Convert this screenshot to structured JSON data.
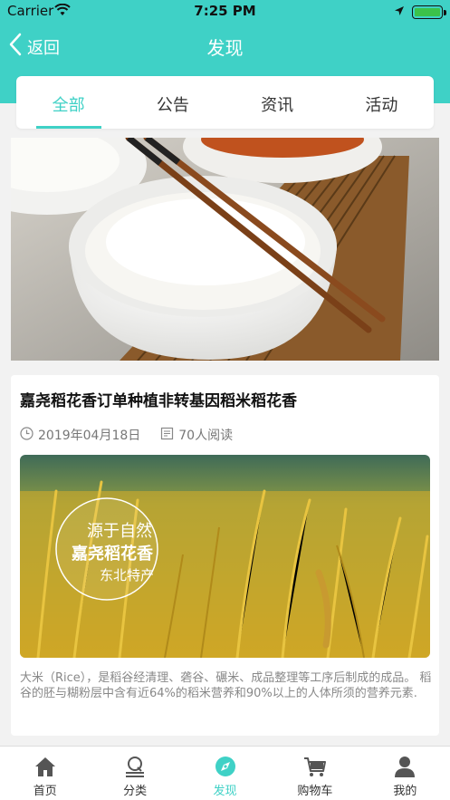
{
  "status_bar": {
    "carrier": "Carrier",
    "time": "7:25 PM"
  },
  "navbar": {
    "back_label": "返回",
    "title": "发现"
  },
  "tabs": [
    {
      "label": "全部",
      "active": true
    },
    {
      "label": "公告",
      "active": false
    },
    {
      "label": "资讯",
      "active": false
    },
    {
      "label": "活动",
      "active": false
    }
  ],
  "article": {
    "title": "嘉尧稻花香订单种植非转基因稻米稻花香",
    "date": "2019年04月18日",
    "reads": "70人阅读",
    "image_text": {
      "line1": "源于自然",
      "line2": "嘉尧稻花香",
      "line3": "东北特产"
    },
    "description": "大米（Rice），是稻谷经清理、砻谷、碾米、成品整理等工序后制成的成品。 稻谷的胚与糊粉层中含有近64%的稻米营养和90%以上的人体所须的营养元素."
  },
  "tabbar": [
    {
      "label": "首页",
      "icon": "home-icon",
      "active": false
    },
    {
      "label": "分类",
      "icon": "category-icon",
      "active": false
    },
    {
      "label": "发现",
      "icon": "discover-icon",
      "active": true
    },
    {
      "label": "购物车",
      "icon": "cart-icon",
      "active": false
    },
    {
      "label": "我的",
      "icon": "profile-icon",
      "active": false
    }
  ],
  "colors": {
    "accent": "#3fd1c6",
    "text": "#333333",
    "muted": "#888888"
  }
}
